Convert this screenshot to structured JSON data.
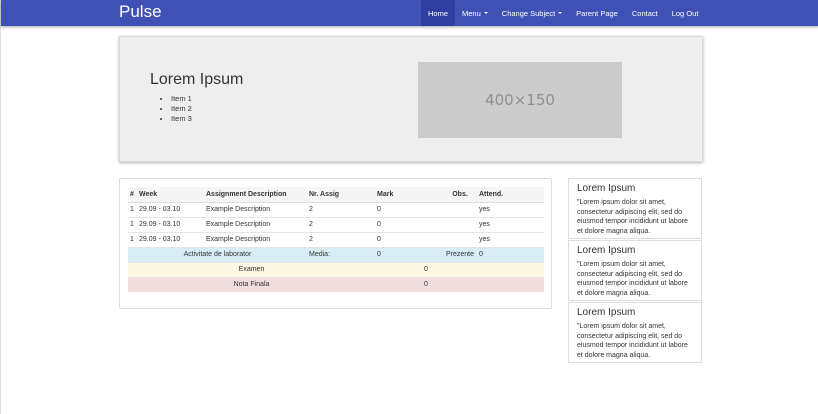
{
  "brand": "Pulse",
  "nav": {
    "home": "Home",
    "menu": "Menu",
    "change_subject": "Change Subject",
    "parent_page": "Parent Page",
    "contact": "Contact",
    "logout": "Log Out"
  },
  "jumbotron": {
    "title": "Lorem Ipsum",
    "items": [
      "Item 1",
      "Item 2",
      "Item 3"
    ],
    "image_label": "400×150"
  },
  "table": {
    "headers": [
      "#",
      "Week",
      "Assignment Description",
      "Nr. Assig",
      "Mark",
      "Obs.",
      "Attend."
    ],
    "rows": [
      [
        "1",
        "29.09 - 03.10",
        "Example Description",
        "2",
        "0",
        "",
        "yes"
      ],
      [
        "1",
        "29.09 - 03.10",
        "Example Description",
        "2",
        "0",
        "",
        "yes"
      ],
      [
        "1",
        "29.09 - 03.10",
        "Example Description",
        "2",
        "0",
        "",
        "yes"
      ]
    ],
    "lab": {
      "label": "Activitate de laborator",
      "media_label": "Media:",
      "media_value": "0",
      "prezente_label": "Prezente",
      "prezente_value": "0"
    },
    "exam": {
      "label": "Examen",
      "value": "0"
    },
    "final": {
      "label": "Nota Finala",
      "value": "0"
    }
  },
  "sidebar": [
    {
      "title": "Lorem Ipsum",
      "text": "\"Lorem ipsum dolor sit amet, consectetur adipiscing elit, sed do eiusmod tempor incididunt ut labore et dolore magna aliqua."
    },
    {
      "title": "Lorem Ipsum",
      "text": "\"Lorem ipsum dolor sit amet, consectetur adipiscing elit, sed do eiusmod tempor incididunt ut labore et dolore magna aliqua."
    },
    {
      "title": "Lorem Ipsum",
      "text": "\"Lorem ipsum dolor sit amet, consectetur adipiscing elit, sed do eiusmod tempor incididunt ut labore et dolore magna aliqua."
    }
  ],
  "colors": {
    "navbar": "#3f51b5",
    "nav_active": "#303f9f",
    "info_row": "#d9edf7",
    "warning_row": "#fcf8e3",
    "danger_row": "#f2dede"
  }
}
